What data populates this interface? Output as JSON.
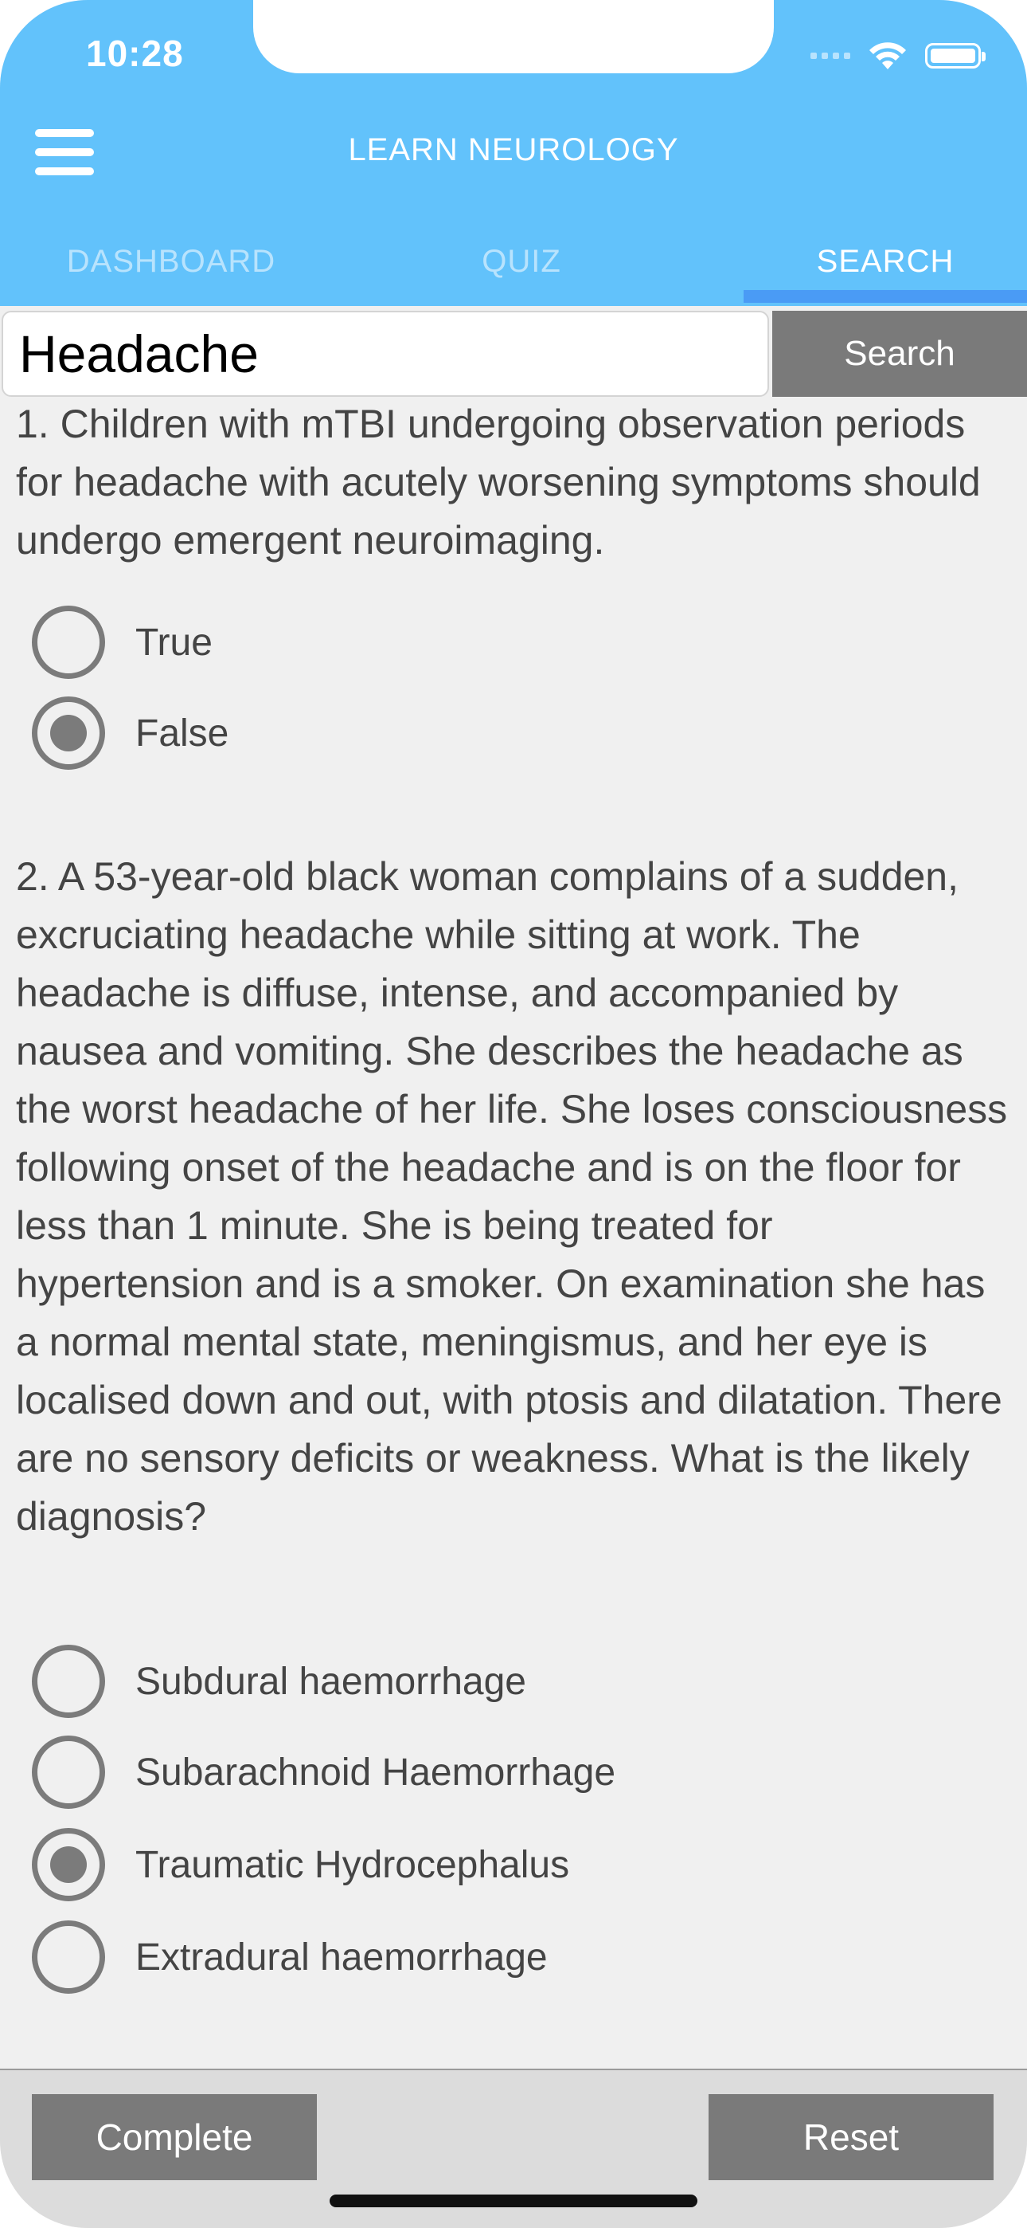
{
  "status_bar": {
    "time": "10:28"
  },
  "header": {
    "title": "LEARN NEUROLOGY",
    "tabs": [
      {
        "label": "DASHBOARD"
      },
      {
        "label": "QUIZ"
      },
      {
        "label": "SEARCH"
      }
    ],
    "active_tab": "SEARCH"
  },
  "search": {
    "value": "Headache",
    "button_label": "Search"
  },
  "questions": [
    {
      "text": "1. Children with mTBI undergoing observation periods for headache with acutely worsening symptoms should undergo emergent neuroimaging.",
      "options": [
        {
          "label": "True",
          "selected": false
        },
        {
          "label": "False",
          "selected": true
        }
      ]
    },
    {
      "text": "2. A 53-year-old black woman complains of a sudden, excruciating headache while sitting at work. The headache is diffuse, intense, and accompanied by nausea and vomiting. She describes the headache as the worst headache of her life. She loses consciousness following onset of the headache and is on the floor for less than 1 minute. She is being treated for hypertension and is a smoker. On examination she has a normal mental state, meningismus, and her eye is localised down and out, with ptosis and dilatation. There are no sensory deficits or weakness. What is the likely diagnosis?",
      "options": [
        {
          "label": "Subdural haemorrhage",
          "selected": false
        },
        {
          "label": "Subarachnoid Haemorrhage",
          "selected": false
        },
        {
          "label": "Traumatic Hydrocephalus",
          "selected": true
        },
        {
          "label": "Extradural haemorrhage",
          "selected": false
        }
      ]
    }
  ],
  "footer": {
    "complete_label": "Complete",
    "reset_label": "Reset"
  },
  "colors": {
    "header": "#62c2fb",
    "tab_indicator": "#4a9bf5",
    "button": "#7a7a7a",
    "background": "#f0f0f0"
  },
  "icons": {
    "menu": "hamburger-menu-icon",
    "wifi": "wifi-icon",
    "battery": "battery-icon",
    "signal": "cellular-signal-icon"
  }
}
